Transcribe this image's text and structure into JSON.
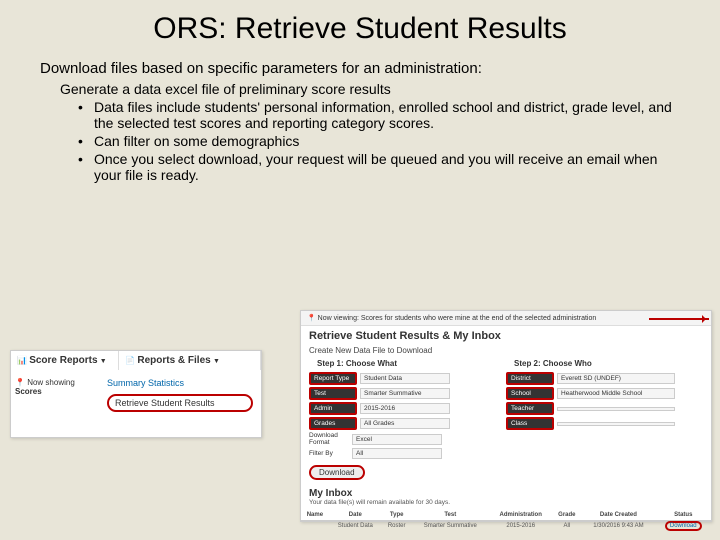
{
  "title": "ORS: Retrieve Student Results",
  "intro": "Download files based on specific parameters for an administration:",
  "sub": "Generate a data excel file of preliminary score results",
  "bullets": [
    "Data files include students' personal information, enrolled school and district, grade level, and the selected test scores and reporting category scores.",
    "Can filter on some demographics",
    "Once you select download, your request will be queued and you will receive an email when your file is ready."
  ],
  "menu": {
    "scoreReports": "Score Reports",
    "reportsFiles": "Reports & Files",
    "nowShowing": "Now showing",
    "scores": "Scores",
    "summary": "Summary Statistics",
    "retrieve": "Retrieve Student Results"
  },
  "main": {
    "topbar": "Now viewing: Scores for students who were mine at the end of the selected administration",
    "heading": "Retrieve Student Results & My Inbox",
    "createNew": "Create New Data File to Download",
    "step1": "Step 1: Choose What",
    "step2": "Step 2: Choose Who",
    "rows1": [
      {
        "label": "Report Type",
        "value": "Student Data"
      },
      {
        "label": "Test",
        "value": "Smarter Summative"
      },
      {
        "label": "Admin",
        "value": "2015-2016"
      },
      {
        "label": "Grades",
        "value": "All Grades"
      }
    ],
    "plain1": [
      {
        "label": "Download Format",
        "value": "Excel"
      },
      {
        "label": "Filter By",
        "value": "All"
      }
    ],
    "rows2": [
      {
        "label": "District",
        "value": "Everett SD (UNDEF)"
      },
      {
        "label": "School",
        "value": "Heatherwood Middle School"
      },
      {
        "label": "Teacher",
        "value": ""
      },
      {
        "label": "Class",
        "value": ""
      }
    ],
    "download": "Download",
    "inbox": "My Inbox",
    "note": "Your data file(s) will remain available for 30 days.",
    "tbl": {
      "h": [
        "Name",
        "Date",
        "Type",
        "Test",
        "Administration",
        "Grade",
        "Date Created",
        "Status"
      ],
      "r": [
        "",
        "Student Data",
        "Roster",
        "Smarter Summative",
        "2015-2016",
        "All",
        "1/30/2016 9:43 AM",
        "Download"
      ]
    }
  }
}
